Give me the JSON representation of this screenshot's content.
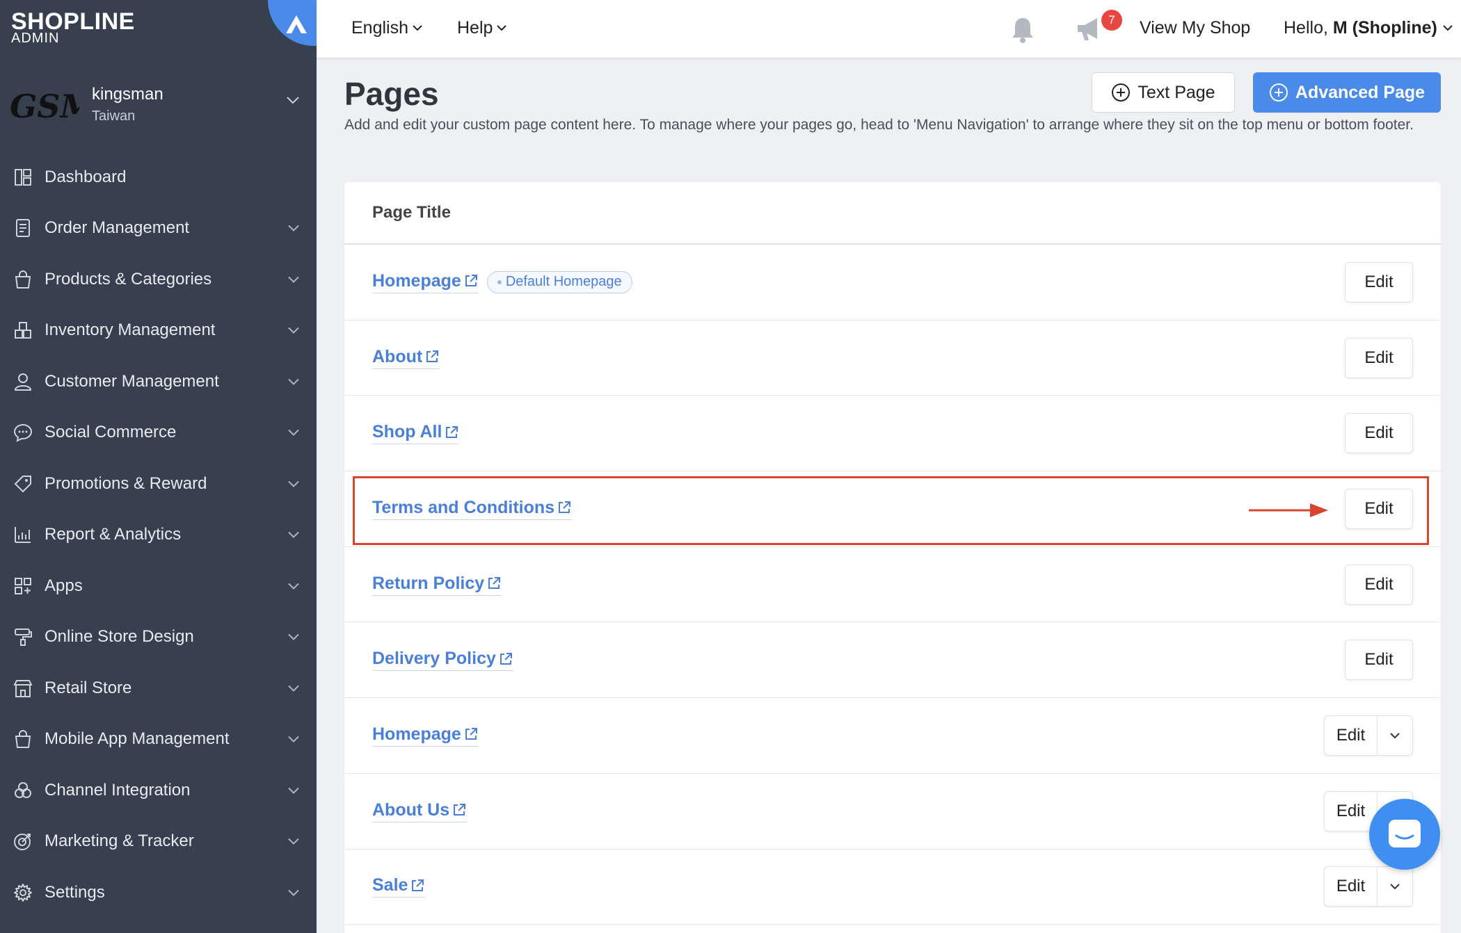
{
  "brand": {
    "logo_text": "SHOPLINE",
    "logo_sub": "ADMIN",
    "accent": "#4a8ae8"
  },
  "store": {
    "logo_text": "GSM",
    "name": "kingsman",
    "region": "Taiwan"
  },
  "sidebar": {
    "items": [
      {
        "label": "Dashboard",
        "icon": "dashboard-icon",
        "has_chevron": false
      },
      {
        "label": "Order Management",
        "icon": "order-icon",
        "has_chevron": true
      },
      {
        "label": "Products & Categories",
        "icon": "shopping-bag-icon",
        "has_chevron": true
      },
      {
        "label": "Inventory Management",
        "icon": "inventory-icon",
        "has_chevron": true
      },
      {
        "label": "Customer Management",
        "icon": "user-icon",
        "has_chevron": true
      },
      {
        "label": "Social Commerce",
        "icon": "chat-bubble-icon",
        "has_chevron": true
      },
      {
        "label": "Promotions & Reward",
        "icon": "tag-icon",
        "has_chevron": true
      },
      {
        "label": "Report & Analytics",
        "icon": "chart-icon",
        "has_chevron": true
      },
      {
        "label": "Apps",
        "icon": "apps-icon",
        "has_chevron": true
      },
      {
        "label": "Online Store Design",
        "icon": "paint-roller-icon",
        "has_chevron": true
      },
      {
        "label": "Retail Store",
        "icon": "store-icon",
        "has_chevron": true
      },
      {
        "label": "Mobile App Management",
        "icon": "shopping-bag-icon",
        "has_chevron": true
      },
      {
        "label": "Channel Integration",
        "icon": "circles-icon",
        "has_chevron": true
      },
      {
        "label": "Marketing & Tracker",
        "icon": "target-icon",
        "has_chevron": true
      },
      {
        "label": "Settings",
        "icon": "gear-icon",
        "has_chevron": true
      }
    ]
  },
  "topbar": {
    "language": "English",
    "help": "Help",
    "notification_count": "7",
    "view_shop": "View My Shop",
    "greeting": "Hello, ",
    "user": "M (Shopline)"
  },
  "main": {
    "title": "Pages",
    "description": "Add and edit your custom page content here. To manage where your pages go, head to 'Menu Navigation' to arrange where they sit on the top menu or bottom footer.",
    "text_page_btn": "Text Page",
    "advanced_page_btn": "Advanced Page",
    "column_header": "Page Title",
    "edit_label": "Edit",
    "rows": [
      {
        "title": "Homepage",
        "tag": "Default Homepage",
        "split": false
      },
      {
        "title": "About",
        "tag": "",
        "split": false
      },
      {
        "title": "Shop All",
        "tag": "",
        "split": false
      },
      {
        "title": "Terms and Conditions",
        "tag": "",
        "split": false
      },
      {
        "title": "Return Policy",
        "tag": "",
        "split": false
      },
      {
        "title": "Delivery Policy",
        "tag": "",
        "split": false
      },
      {
        "title": "Homepage",
        "tag": "",
        "split": true
      },
      {
        "title": "About Us",
        "tag": "",
        "split": true
      },
      {
        "title": "Sale",
        "tag": "",
        "split": true
      }
    ]
  },
  "colors": {
    "sidebar_bg": "#36404f",
    "link": "#4a7fd9",
    "highlight": "#d9432f",
    "badge": "#e8463e"
  }
}
